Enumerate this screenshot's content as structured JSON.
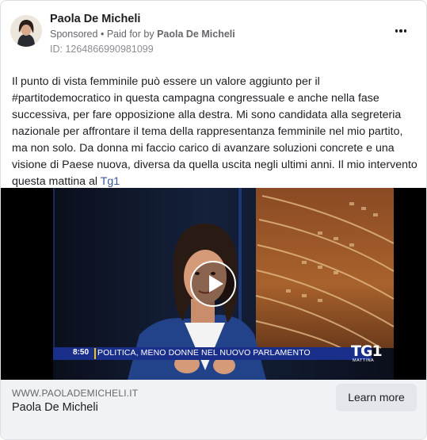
{
  "ad": {
    "advertiser_name": "Paola De Micheli",
    "sponsored_label": "Sponsored",
    "separator": "•",
    "paid_for_prefix": "Paid for by",
    "paid_for_name": "Paola De Micheli",
    "id_label": "ID: 1264866990981099",
    "more_options_icon": "more-horizontal-icon"
  },
  "post": {
    "text": "Il punto di vista femminile può essere un valore aggiunto per il #partitodemocratico in questa campagna congressuale e anche nella fase successiva, per fare opposizione alla destra. Mi sono candidata alla segreteria nazionale per affrontare il tema della rappresentanza femminile nel mio partito, ma non solo. Da donna mi faccio carico di avanzare soluzioni concrete e una visione di Paese nuova, diversa da quella uscita negli ultimi anni. Il mio intervento questa mattina al ",
    "link_text": "Tg1"
  },
  "video": {
    "ticker_time": "8:50",
    "ticker_text": "POLITICA, MENO DONNE NEL NUOVO PARLAMENTO",
    "channel_logo": "TG1",
    "channel_sub": "MATTINA",
    "play_icon": "play-icon"
  },
  "footer": {
    "domain": "WWW.PAOLADEMICHELI.IT",
    "title": "Paola De Micheli",
    "cta_label": "Learn more"
  },
  "colors": {
    "ticker_blue": "#1a2f8a",
    "link_blue": "#385898",
    "footer_bg": "#f0f2f5",
    "cta_bg": "#e4e6eb"
  }
}
